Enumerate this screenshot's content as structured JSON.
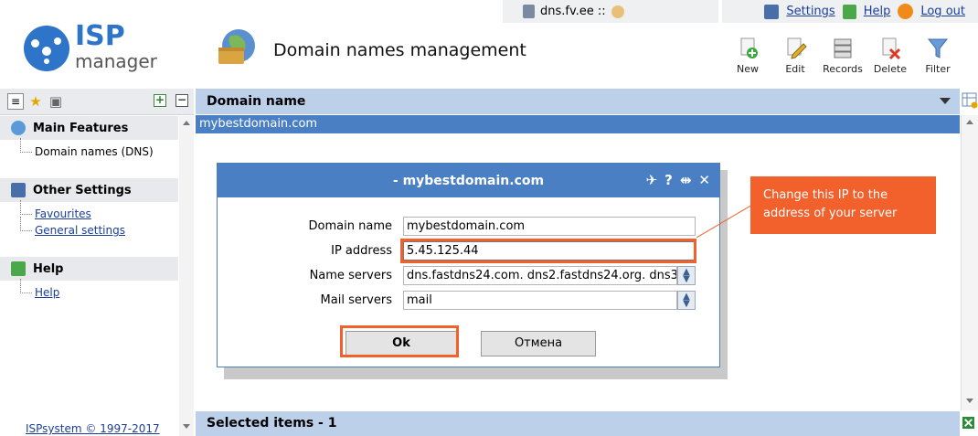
{
  "header": {
    "user_host": "dns.fv.ee ::",
    "links": {
      "settings": "Settings",
      "help": "Help",
      "logout": "Log out"
    },
    "logo": {
      "line1": "ISP",
      "line2": "manager"
    },
    "page_title": "Domain names management"
  },
  "toolbar": {
    "items": [
      {
        "label": "New",
        "icon": "new-document-icon"
      },
      {
        "label": "Edit",
        "icon": "edit-pencil-icon"
      },
      {
        "label": "Records",
        "icon": "records-stack-icon"
      },
      {
        "label": "Delete",
        "icon": "delete-icon"
      },
      {
        "label": "Filter",
        "icon": "filter-funnel-icon"
      }
    ]
  },
  "sidebar": {
    "sections": [
      {
        "title": "Main Features",
        "items": [
          {
            "label": "Domain names (DNS)",
            "link": false
          }
        ]
      },
      {
        "title": "Other Settings",
        "items": [
          {
            "label": "Favourites",
            "link": true
          },
          {
            "label": "General settings",
            "link": true
          }
        ]
      },
      {
        "title": "Help",
        "items": [
          {
            "label": "Help",
            "link": true
          }
        ]
      }
    ],
    "footer": "ISPsystem © 1997-2017"
  },
  "table": {
    "column_header": "Domain name",
    "rows": [
      "mybestdomain.com"
    ],
    "footer": "Selected items - 1"
  },
  "dialog": {
    "title": "- mybestdomain.com",
    "fields": {
      "domain_name": {
        "label": "Domain name",
        "value": "mybestdomain.com"
      },
      "ip_address": {
        "label": "IP address",
        "value": "5.45.125.44"
      },
      "name_servers": {
        "label": "Name servers",
        "value": "dns.fastdns24.com. dns2.fastdns24.org. dns3"
      },
      "mail_servers": {
        "label": "Mail servers",
        "value": "mail"
      }
    },
    "ok_label": "Ok",
    "cancel_label": "Отмена"
  },
  "annotation": {
    "callout_text": "Change this IP to the address of your server"
  },
  "colors": {
    "accent_blue": "#4b7fc4",
    "header_blue": "#bcd0ea",
    "highlight_orange": "#f2602b"
  }
}
